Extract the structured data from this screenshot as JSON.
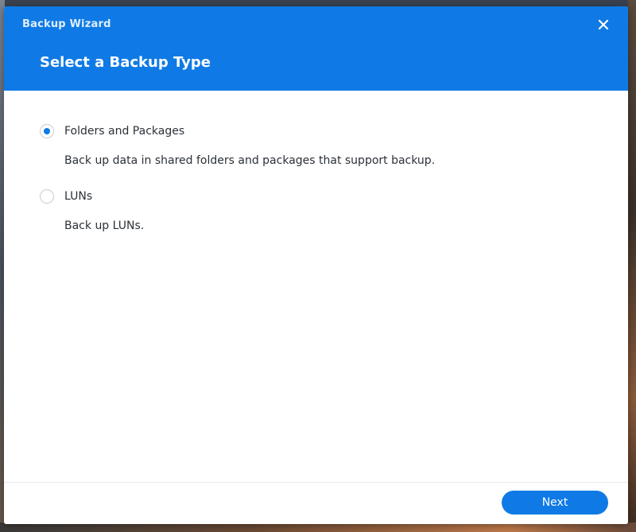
{
  "window": {
    "app_title": "Backup Wizard",
    "step_title": "Select a Backup Type",
    "close_icon": "close-icon"
  },
  "options": [
    {
      "label": "Folders and Packages",
      "description": "Back up data in shared folders and packages that support backup.",
      "selected": true
    },
    {
      "label": "LUNs",
      "description": "Back up LUNs.",
      "selected": false
    }
  ],
  "footer": {
    "next_label": "Next"
  },
  "colors": {
    "accent": "#0f7ae5",
    "header_text": "#ffffff",
    "body_text": "#2b3138"
  }
}
